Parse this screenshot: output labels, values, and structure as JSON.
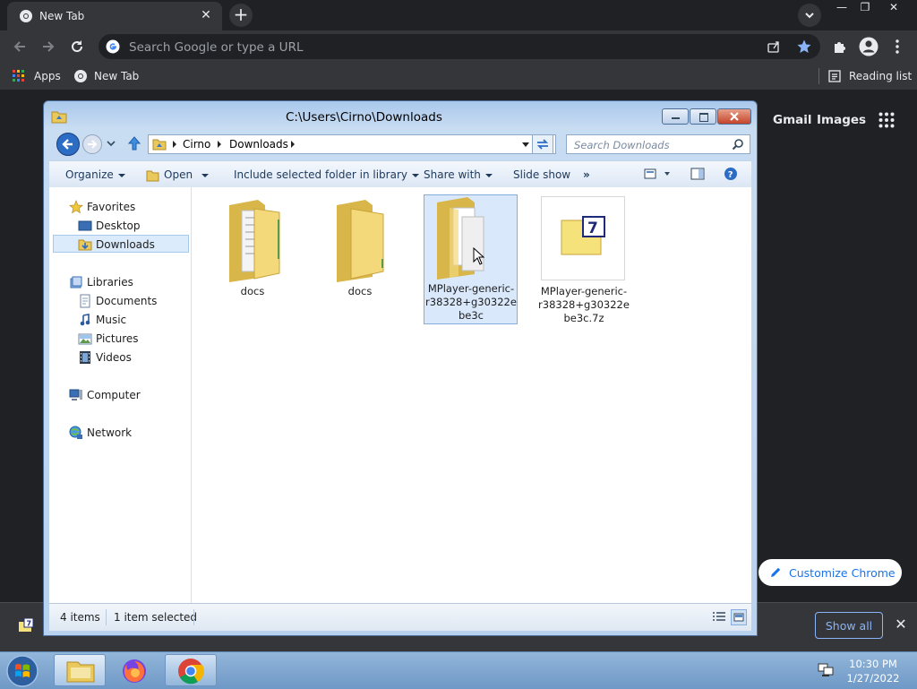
{
  "chrome": {
    "tab_title": "New Tab",
    "tab_close": "✕",
    "new_tab": "+",
    "window_buttons": {
      "minimize": "—",
      "restore": "❐",
      "close": "✕"
    },
    "omnibox_placeholder": "Search Google or type a URL",
    "bookmarks": {
      "apps": "Apps",
      "new_tab": "New Tab",
      "reading_list": "Reading list"
    },
    "accent": "#8ab4f8",
    "ntp": {
      "gmail": "Gmail",
      "images": "Images",
      "customize": "Customize Chrome"
    },
    "downloads_bar": {
      "show_all": "Show all",
      "close": "✕"
    }
  },
  "explorer": {
    "title": "C:\\Users\\Cirno\\Downloads",
    "breadcrumb": [
      "Cirno",
      "Downloads"
    ],
    "search_placeholder": "Search Downloads",
    "commands": [
      "Organize",
      "Open",
      "Include selected folder in library",
      "Share with",
      "Slide show",
      "»"
    ],
    "nav": {
      "favorites": "Favorites",
      "favorites_items": [
        "Desktop",
        "Downloads"
      ],
      "libraries": "Libraries",
      "libraries_items": [
        "Documents",
        "Music",
        "Pictures",
        "Videos"
      ],
      "computer": "Computer",
      "network": "Network"
    },
    "files": [
      {
        "name": "docs",
        "type": "folder-docs"
      },
      {
        "name": "docs",
        "type": "folder"
      },
      {
        "name": "MPlayer-generic-r38328+g30322ebe3c",
        "type": "folder-selected"
      },
      {
        "name": "MPlayer-generic-r38328+g30322ebe3c.7z",
        "type": "7z-archive"
      }
    ],
    "status": {
      "count": "4 items",
      "selected": "1 item selected"
    }
  },
  "taskbar": {
    "time": "10:30 PM",
    "date": "1/27/2022"
  }
}
